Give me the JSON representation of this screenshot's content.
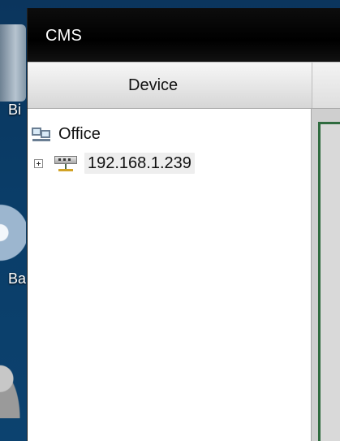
{
  "desktop": {
    "labels": {
      "bi": "Bi",
      "ba": "Ba"
    }
  },
  "window": {
    "title": "CMS"
  },
  "device_panel": {
    "header": "Device",
    "tree": {
      "group_label": "Office",
      "device_ip": "192.168.1.239"
    }
  },
  "icons": {
    "office": "office-group-icon",
    "network": "network-device-icon",
    "expand": "expand-plus-icon"
  }
}
